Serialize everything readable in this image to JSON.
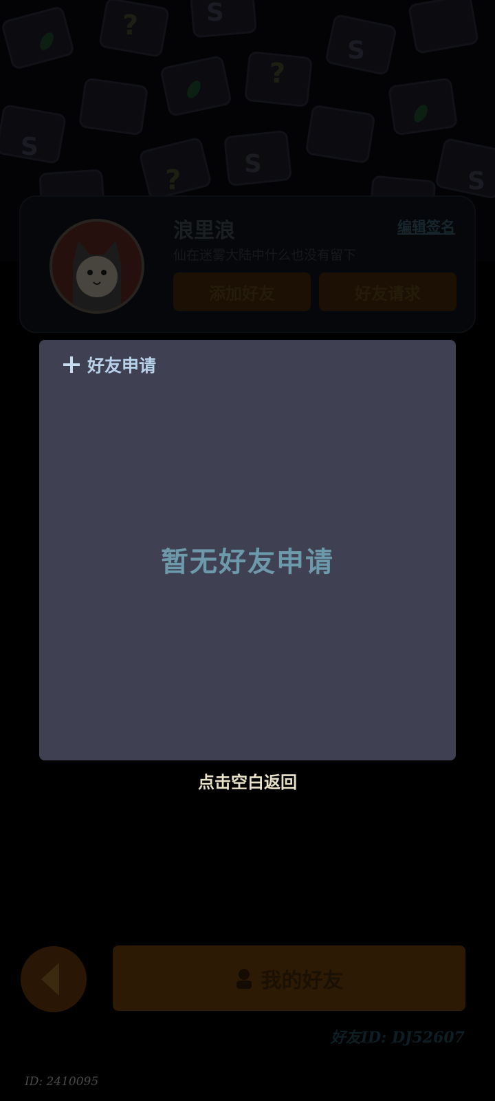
{
  "profile": {
    "nickname": "浪里浪",
    "edit_signature_label": "编辑签名",
    "signature": "仙在迷雾大陆中什么也没有留下",
    "add_friend_label": "添加好友",
    "friend_requests_label": "好友请求"
  },
  "panel": {
    "title": "好友申请",
    "empty_message": "暂无好友申请"
  },
  "hint": "点击空白返回",
  "bottom": {
    "my_friends_label": "我的好友",
    "friend_id": "好友ID: DJ52607",
    "user_id": "ID: 2410095"
  },
  "icons": {
    "plus": "plus-icon",
    "back": "back-arrow-icon",
    "friends": "person-icon",
    "avatar": "cat-avatar"
  },
  "colors": {
    "panel_bg": "#3f4152",
    "panel_title": "#b8d2ea",
    "empty_message": "#6c9aab",
    "hint_text": "#e9e2c7"
  }
}
